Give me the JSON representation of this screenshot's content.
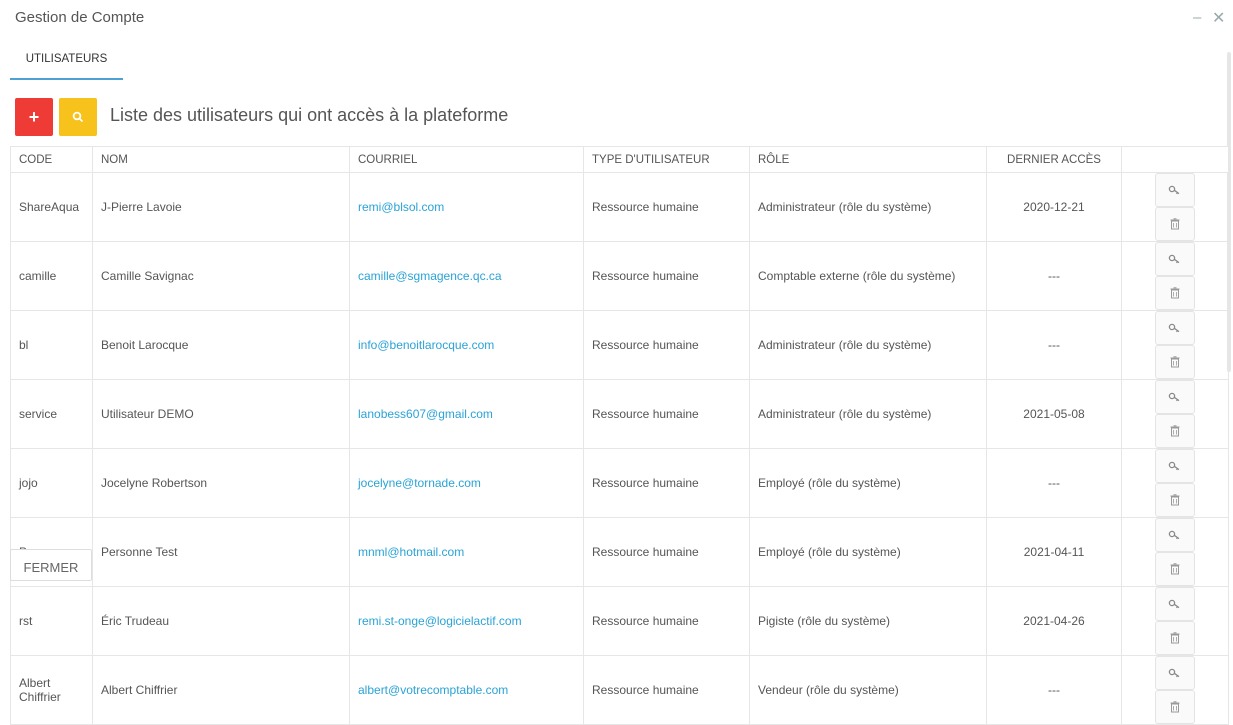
{
  "window": {
    "title": "Gestion de Compte",
    "minimize": "–",
    "close": "✕"
  },
  "tabs": [
    {
      "label": "UTILISATEURS"
    }
  ],
  "toolbar": {
    "add_icon": "+",
    "list_title": "Liste des utilisateurs qui ont accès à la plateforme"
  },
  "table": {
    "headers": {
      "code": "CODE",
      "nom": "NOM",
      "courriel": "COURRIEL",
      "type": "TYPE D'UTILISATEUR",
      "role": "RÔLE",
      "dernier": "DERNIER ACCÈS"
    },
    "rows": [
      {
        "code": "ShareAqua",
        "nom": "J-Pierre Lavoie",
        "courriel": "remi@blsol.com",
        "type": "Ressource humaine",
        "role": "Administrateur (rôle du système)",
        "dernier": "2020-12-21"
      },
      {
        "code": "camille",
        "nom": "Camille Savignac",
        "courriel": "camille@sgmagence.qc.ca",
        "type": "Ressource humaine",
        "role": "Comptable externe (rôle du système)",
        "dernier": "---"
      },
      {
        "code": "bl",
        "nom": "Benoit Larocque",
        "courriel": "info@benoitlarocque.com",
        "type": "Ressource humaine",
        "role": "Administrateur (rôle du système)",
        "dernier": "---"
      },
      {
        "code": "service",
        "nom": "Utilisateur DEMO",
        "courriel": "lanobess607@gmail.com",
        "type": "Ressource humaine",
        "role": "Administrateur (rôle du système)",
        "dernier": "2021-05-08"
      },
      {
        "code": "jojo",
        "nom": "Jocelyne Robertson",
        "courriel": "jocelyne@tornade.com",
        "type": "Ressource humaine",
        "role": "Employé (rôle du système)",
        "dernier": "---"
      },
      {
        "code": "Personne",
        "nom": "Personne Test",
        "courriel": "mnml@hotmail.com",
        "type": "Ressource humaine",
        "role": "Employé (rôle du système)",
        "dernier": "2021-04-11"
      },
      {
        "code": "rst",
        "nom": "Éric Trudeau",
        "courriel": "remi.st-onge@logicielactif.com",
        "type": "Ressource humaine",
        "role": "Pigiste (rôle du système)",
        "dernier": "2021-04-26"
      },
      {
        "code": "Albert Chiffrier",
        "nom": "Albert Chiffrier",
        "courriel": "albert@votrecomptable.com",
        "type": "Ressource humaine",
        "role": "Vendeur (rôle du système)",
        "dernier": "---"
      }
    ]
  },
  "footer": {
    "close_label": "FERMER"
  },
  "icons": {
    "add": "plus-icon",
    "search": "search-icon",
    "key": "key-icon",
    "delete": "trash-icon"
  },
  "colors": {
    "accent": "#4ea1d3",
    "add_button": "#ef3b36",
    "search_button": "#f6c21b",
    "link": "#2aa3d6"
  }
}
